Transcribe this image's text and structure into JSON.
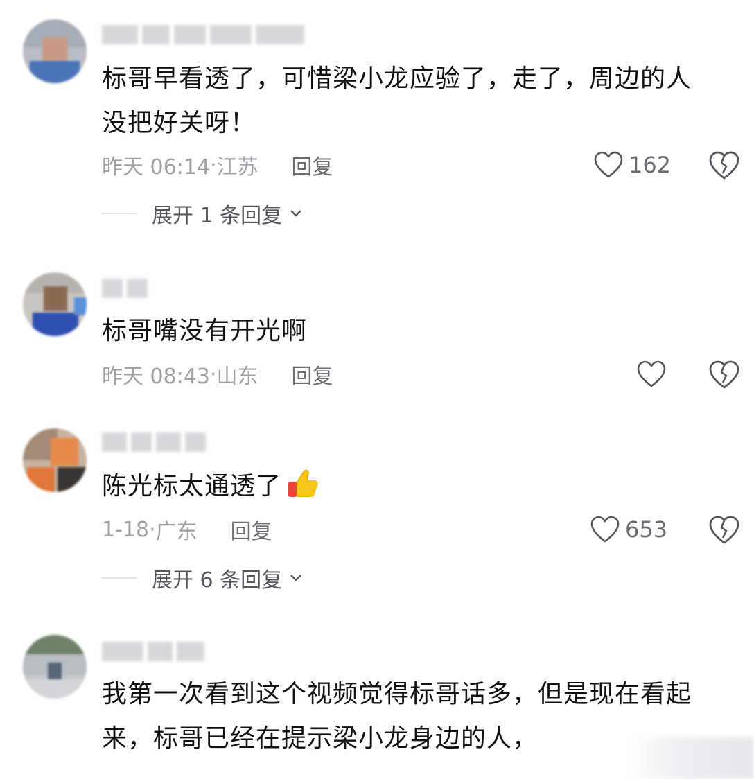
{
  "comments": [
    {
      "text_line1": "标哥早看透了，可惜梁小龙应验了，走了，周边的人",
      "text_line2": "没把好关呀！",
      "time": "昨天 06:14",
      "location": "江苏",
      "reply_label": "回复",
      "likes": "162",
      "expand_label": "展开 1 条回复"
    },
    {
      "text_line1": "标哥嘴没有开光啊",
      "time": "昨天 08:43",
      "location": "山东",
      "reply_label": "回复",
      "likes": ""
    },
    {
      "text_line1": "陈光标太通透了",
      "time": "1-18",
      "location": "广东",
      "reply_label": "回复",
      "likes": "653",
      "expand_label": "展开 6 条回复"
    },
    {
      "text_line1": "我第一次看到这个视频觉得标哥话多，但是现在看起",
      "text_line2": "来，标哥已经在提示梁小龙身边的人，"
    }
  ],
  "separator": "·",
  "colors": {
    "text": "#111111",
    "meta": "#a0a0a8",
    "action": "#6b6b74"
  },
  "icons": {
    "like": "heart-outline-icon",
    "dislike": "broken-heart-icon",
    "expand": "chevron-down-icon",
    "emoji": "thumbs-up-emoji"
  }
}
